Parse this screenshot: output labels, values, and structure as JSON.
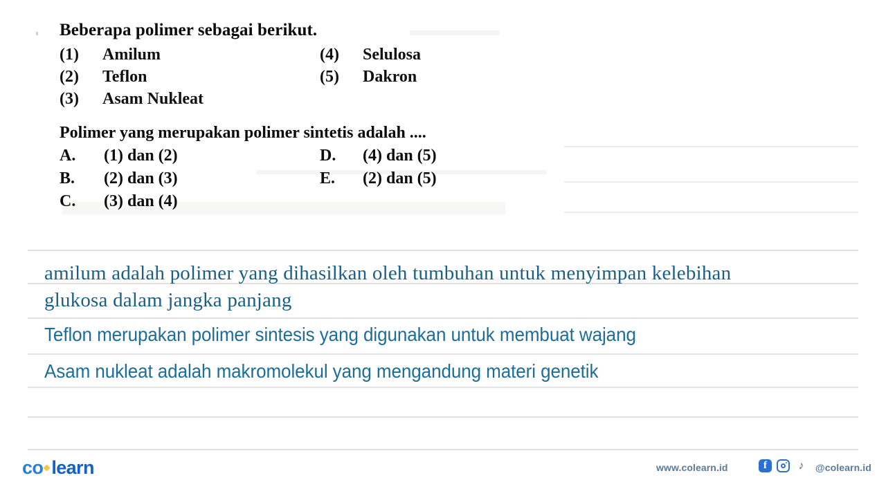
{
  "question": {
    "title": "Beberapa polimer sebagai berikut.",
    "items_left": [
      {
        "num": "(1)",
        "name": "Amilum"
      },
      {
        "num": "(2)",
        "name": "Teflon"
      },
      {
        "num": "(3)",
        "name": "Asam Nukleat"
      }
    ],
    "items_right": [
      {
        "num": "(4)",
        "name": "Selulosa"
      },
      {
        "num": "(5)",
        "name": "Dakron"
      }
    ],
    "prompt": "Polimer yang merupakan polimer sintetis adalah ....",
    "choices_left": [
      {
        "key": "A.",
        "text": "(1) dan (2)"
      },
      {
        "key": "B.",
        "text": "(2) dan (3)"
      },
      {
        "key": "C.",
        "text": "(3) dan (4)"
      }
    ],
    "choices_right": [
      {
        "key": "D.",
        "text": "(4) dan (5)"
      },
      {
        "key": "E.",
        "text": "(2) dan (5)"
      }
    ]
  },
  "answer": {
    "line1": "amilum  adalah polimer yang dihasilkan oleh tumbuhan untuk menyimpan kelebihan",
    "line2": "glukosa dalam jangka panjang",
    "line3": "Teflon merupakan polimer sintesis yang digunakan untuk membuat wajang",
    "line4": "Asam nukleat adalah makromolekul yang mengandung materi genetik",
    "text_color_serif": "#1a5f85",
    "text_color_sans": "#1d6d99"
  },
  "footer": {
    "logo_first": "co",
    "logo_second": "learn",
    "url": "www.colearn.id",
    "handle": "@colearn.id",
    "facebook_glyph": "f",
    "tiktok_glyph": "♪",
    "brand_blue": "#1262c4",
    "accent_yellow": "#f5c542"
  }
}
